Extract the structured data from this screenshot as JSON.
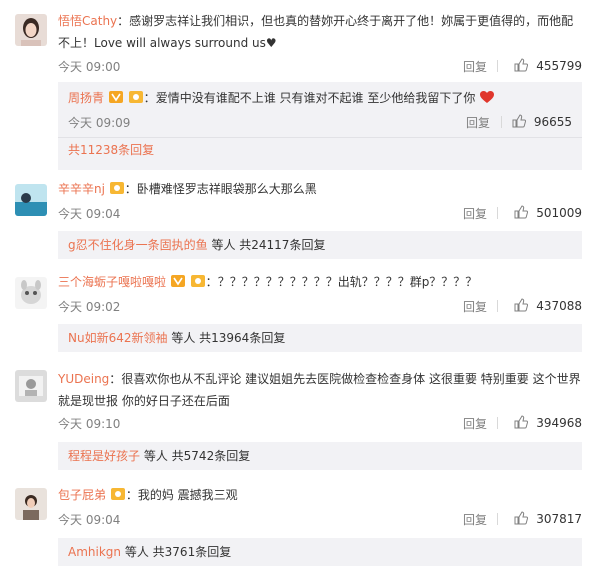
{
  "comments": [
    {
      "user": "悟悟Cathy",
      "text": "感谢罗志祥让我们相识，但也真的替妳开心终于离开了他！妳属于更值得的，而他配不上！Love will always surround us♥",
      "time": "今天 09:00",
      "reply_label": "回复",
      "likes": "455799",
      "sub": {
        "user": "周扬青",
        "text": "爱情中没有谁配不上谁 只有谁对不起谁 至少他给我留下了你",
        "time": "今天 09:09",
        "reply_label": "回复",
        "likes": "96655"
      },
      "more": "共11238条回复"
    },
    {
      "user": "辛辛辛nj",
      "text": "卧槽难怪罗志祥眼袋那么大那么黑",
      "time": "今天 09:04",
      "reply_label": "回复",
      "likes": "501009",
      "more_user": "g忍不住化身一条固执的鱼",
      "more": "等人 共24117条回复"
    },
    {
      "user": "三个海蛎子嘎啦嘎啦",
      "text": "？？？？？？？？？？出轨？？？？群p？？？？",
      "time": "今天 09:02",
      "reply_label": "回复",
      "likes": "437088",
      "more_user": "Nu如新642新领袖",
      "more": "等人 共13964条回复"
    },
    {
      "user": "YUDeing",
      "text": "很喜欢你也从不乱评论 建议姐姐先去医院做检查检查身体 这很重要 特别重要 这个世界就是现世报 你的好日子还在后面",
      "time": "今天 09:10",
      "reply_label": "回复",
      "likes": "394968",
      "more_user": "程程是好孩子",
      "more": "等人 共5742条回复"
    },
    {
      "user": "包子屁弟",
      "text": "我的妈 震撼我三观",
      "time": "今天 09:04",
      "reply_label": "回复",
      "likes": "307817",
      "more_user": "Amhikgn",
      "more": "等人 共3761条回复"
    }
  ],
  "colors": {
    "username": "#eb7350",
    "subbox": "#f2f2f5",
    "meta": "#808080",
    "heart": "#e0362c"
  },
  "icons": {
    "like": "thumb-up-icon",
    "badge": "member-badge-icon",
    "heart": "red-heart-icon"
  }
}
